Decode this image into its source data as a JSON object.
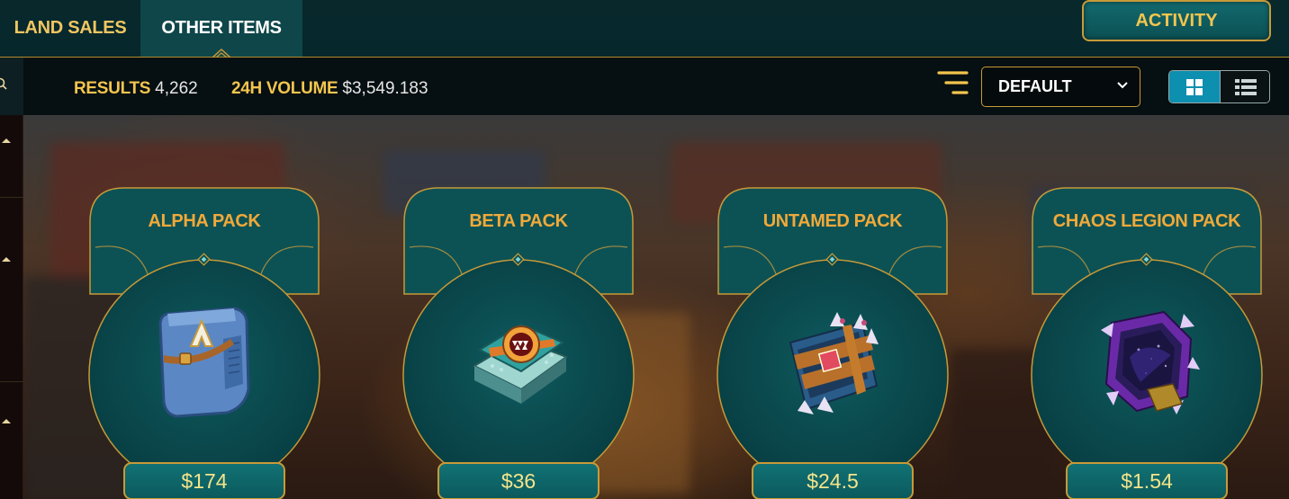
{
  "tabs": {
    "land_sales": "LAND SALES",
    "other_items": "OTHER ITEMS",
    "activity": "ACTIVITY"
  },
  "stats": {
    "results_label": "RESULTS",
    "results_value": "4,262",
    "volume_label": "24H VOLUME",
    "volume_value": "$3,549.183"
  },
  "sort": {
    "selected": "DEFAULT"
  },
  "view": {
    "active": "grid"
  },
  "packs": [
    {
      "name": "ALPHA PACK",
      "price": "$174",
      "art": "alpha-pack-icon"
    },
    {
      "name": "BETA PACK",
      "price": "$36",
      "art": "beta-pack-icon"
    },
    {
      "name": "UNTAMED PACK",
      "price": "$24.5",
      "art": "untamed-pack-icon"
    },
    {
      "name": "CHAOS LEGION PACK",
      "price": "$1.54",
      "art": "chaos-legion-pack-icon"
    }
  ],
  "colors": {
    "gold": "#c79a38",
    "title_gold": "#f0a93a",
    "teal": "#0b5a5d",
    "accent_blue": "#0d8fb0"
  }
}
